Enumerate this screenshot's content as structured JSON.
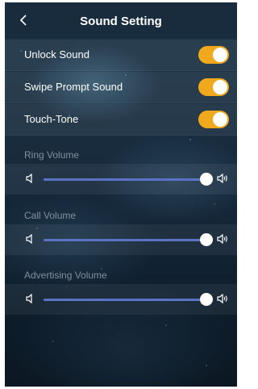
{
  "header": {
    "title": "Sound Setting"
  },
  "toggles": [
    {
      "label": "Unlock Sound",
      "on": true
    },
    {
      "label": "Swipe Prompt Sound",
      "on": true
    },
    {
      "label": "Touch-Tone",
      "on": true
    }
  ],
  "volumes": [
    {
      "label": "Ring Volume",
      "level_percent": 100
    },
    {
      "label": "Call Volume",
      "level_percent": 100
    },
    {
      "label": "Advertising Volume",
      "level_percent": 100
    }
  ],
  "colors": {
    "accent_toggle": "#f0a81c",
    "slider_track": "#4a5f9a"
  },
  "icons": {
    "back": "chevron-left-icon",
    "volume_low": "speaker-low-icon",
    "volume_high": "speaker-high-icon"
  }
}
